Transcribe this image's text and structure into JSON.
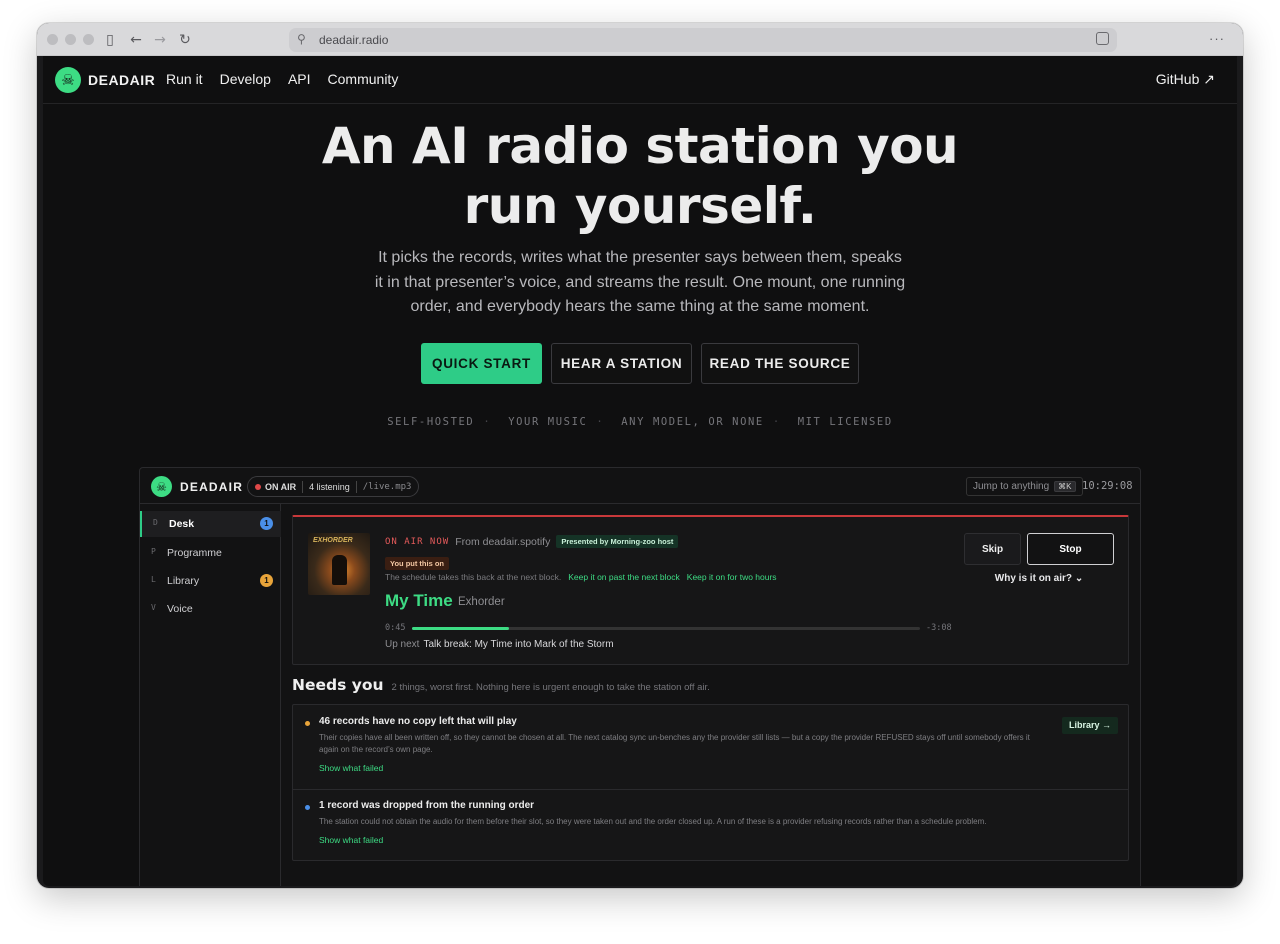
{
  "browser": {
    "url": "deadair.radio"
  },
  "nav": {
    "brand": "DEADAIR",
    "links": [
      "Run it",
      "Develop",
      "API",
      "Community"
    ],
    "github": "GitHub ↗"
  },
  "hero": {
    "title_line1": "An AI radio station you",
    "title_line2": "run yourself.",
    "subtitle": "It picks the records, writes what the presenter says between them, speaks it in that presenter’s voice, and streams the result. One mount, one running order, and everybody hears the same thing at the same moment.",
    "buttons": {
      "quick_start": "QUICK START",
      "hear": "HEAR A STATION",
      "source": "READ THE SOURCE"
    },
    "tagline": [
      "SELF-HOSTED",
      "YOUR MUSIC",
      "ANY MODEL, OR NONE",
      "MIT LICENSED"
    ]
  },
  "app": {
    "brand": "DEADAIR",
    "on_air": "ON AIR",
    "listening": "4 listening",
    "mount": "/live.mp3",
    "jump": "Jump to anything",
    "jump_key": "⌘K",
    "clock": "10:29:08",
    "sidebar": [
      {
        "key": "D",
        "label": "Desk",
        "badge": "1",
        "badge_color": "#4a8fe8"
      },
      {
        "key": "P",
        "label": "Programme"
      },
      {
        "key": "L",
        "label": "Library",
        "badge": "1",
        "badge_color": "#e8a43a"
      },
      {
        "key": "V",
        "label": "Voice"
      }
    ],
    "now": {
      "label": "ON AIR NOW",
      "from": "From deadair.spotify",
      "presented": "Presented by Morning-zoo host",
      "put": "You put this on",
      "schedule": "The schedule takes this back at the next block.",
      "keep1": "Keep it on past the next block",
      "keep2": "Keep it on for two hours",
      "title": "My Time",
      "artist": "Exhorder",
      "elapsed": "0:45",
      "remaining": "-3:08",
      "progress": 0.19,
      "upnext_label": "Up next",
      "upnext": "Talk break: My Time into Mark of the Storm",
      "skip": "Skip",
      "stop": "Stop",
      "why": "Why is it on air?",
      "art_text": "EXHORDER"
    },
    "needs": {
      "title": "Needs you",
      "subtitle": "2 things, worst first. Nothing here is urgent enough to take the station off air.",
      "issues": [
        {
          "title": "46 records have no copy left that will play",
          "desc": "Their copies have all been written off, so they cannot be chosen at all. The next catalog sync un-benches any the provider still lists — but a copy the provider REFUSED stays off until somebody offers it again on the record’s own page.",
          "link": "Show what failed",
          "button": "Library →",
          "color": "#e8a43a"
        },
        {
          "title": "1 record was dropped from the running order",
          "desc": "The station could not obtain the audio for them before their slot, so they were taken out and the order closed up. A run of these is a provider refusing records rather than a schedule problem.",
          "link": "Show what failed",
          "color": "#4a8fe8"
        }
      ]
    }
  }
}
